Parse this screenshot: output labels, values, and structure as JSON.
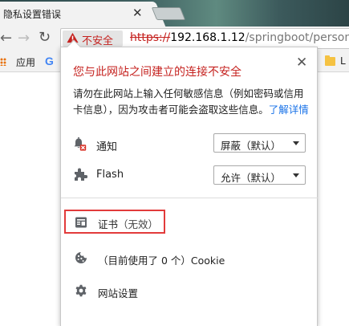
{
  "tab": {
    "title": "隐私设置错误",
    "close": "✕"
  },
  "toolbar": {
    "back": "←",
    "forward": "→",
    "reload": "↻",
    "security_chip": "不安全",
    "url": {
      "scheme": "https://",
      "host": "192.168.1.12",
      "path": "/springboot/person"
    }
  },
  "bookmarks": {
    "apps": "应用",
    "google": "G",
    "folder_partial": "L"
  },
  "popup": {
    "title": "您与此网站之间建立的连接不安全",
    "close": "✕",
    "description": "请勿在此网站上输入任何敏感信息（例如密码或信用卡信息），因为攻击者可能会盗取这些信息。",
    "learn_more": "了解详情",
    "permissions": [
      {
        "icon": "notification-bell-icon",
        "label": "通知",
        "value": "屏蔽（默认）"
      },
      {
        "icon": "flash-plugin-icon",
        "label": "Flash",
        "value": "允许（默认）"
      }
    ],
    "certificate": {
      "label": "证书",
      "status": "（无效）"
    },
    "cookies": "（目前使用了 0 个）Cookie",
    "site_settings": "网站设置"
  },
  "colors": {
    "danger": "#c5221f",
    "link": "#1a73e8",
    "highlight_box": "#e23b3b"
  }
}
